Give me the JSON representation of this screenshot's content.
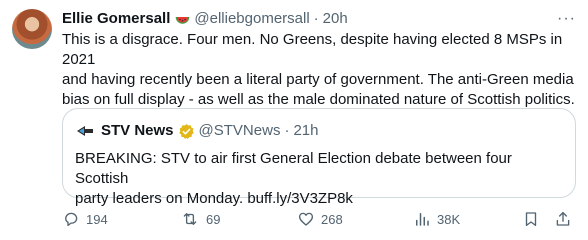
{
  "tweet": {
    "author_name": "Ellie Gomersall",
    "author_handle": "@elliebgomersall",
    "separator": "·",
    "time": "20h",
    "more_label": "···",
    "text_lines": [
      "This is a disgrace. Four men. No Greens, despite having elected 8 MSPs in 2021",
      "and having recently been a literal party of government. The anti-Green media",
      "bias on full display - as well as the male dominated nature of Scottish politics."
    ]
  },
  "quoted": {
    "author_name": "STV News",
    "author_handle": "@STVNews",
    "separator": "·",
    "time": "21h",
    "text_lines": [
      "BREAKING: STV to air first General Election debate between four Scottish",
      "party leaders on Monday. buff.ly/3V3ZP8k"
    ]
  },
  "actions": {
    "replies": "194",
    "retweets": "69",
    "likes": "268",
    "views": "38K"
  },
  "colors": {
    "text": "#0f1419",
    "muted": "#536471",
    "border": "#cfd9de",
    "verified_gold": "#e2b719"
  }
}
